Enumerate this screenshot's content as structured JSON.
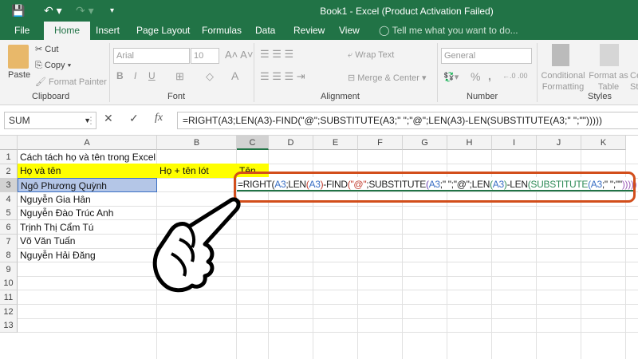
{
  "window": {
    "title": "Book1 - Excel (Product Activation Failed)"
  },
  "quick_access": {
    "save_icon": "save-icon",
    "undo_icon": "undo-icon",
    "redo_icon": "redo-icon",
    "customize_icon": "customize-icon"
  },
  "tabs": [
    {
      "label": "File"
    },
    {
      "label": "Home",
      "active": true
    },
    {
      "label": "Insert"
    },
    {
      "label": "Page Layout"
    },
    {
      "label": "Formulas"
    },
    {
      "label": "Data"
    },
    {
      "label": "Review"
    },
    {
      "label": "View"
    }
  ],
  "tell_me": "Tell me what you want to do...",
  "ribbon": {
    "clipboard": {
      "paste": "Paste",
      "cut": "Cut",
      "copy": "Copy",
      "format_painter": "Format Painter",
      "label": "Clipboard"
    },
    "font": {
      "font_name": "Arial",
      "font_size": "10",
      "label": "Font",
      "bold": "B",
      "italic": "I",
      "underline": "U",
      "font_color": "A"
    },
    "alignment": {
      "wrap_text": "Wrap Text",
      "merge_center": "Merge & Center",
      "label": "Alignment"
    },
    "number": {
      "format": "General",
      "percent": "%",
      "comma": ",",
      "label": "Number"
    },
    "styles": {
      "conditional_formatting": "Conditional Formatting",
      "format_as_table": "Format as Table",
      "cell_styles": "Cell Styles",
      "label": "Styles"
    }
  },
  "formula_bar": {
    "name_box": "SUM",
    "formula": "=RIGHT(A3;LEN(A3)-FIND(\"@\";SUBSTITUTE(A3;\" \";\"@\";LEN(A3)-LEN(SUBSTITUTE(A3;\" \";\"\")))))"
  },
  "columns": [
    "A",
    "B",
    "C",
    "D",
    "E",
    "F",
    "G",
    "H",
    "I",
    "J",
    "K"
  ],
  "rows": [
    "1",
    "2",
    "3",
    "4",
    "5",
    "6",
    "7",
    "8",
    "9",
    "10",
    "11",
    "12",
    "13"
  ],
  "cells": {
    "A1": "Cách tách họ và tên trong Excel",
    "A2": "Họ và tên",
    "B2": "Họ + tên lót",
    "C2": "Tên",
    "A3": "Ngô Phương Quỳnh",
    "A4": "Nguyễn Gia Hân",
    "A5": "Nguyễn Đào Trúc Anh",
    "A6": "Trịnh Thị Cẩm Tú",
    "A7": "Võ Văn Tuấn",
    "A8": "Nguyễn Hải Đăng"
  },
  "in_cell_formula": [
    {
      "t": "=RIGHT(",
      "c": "#222"
    },
    {
      "t": "A3",
      "c": "#3a6fc4"
    },
    {
      "t": ";LEN",
      "c": "#222"
    },
    {
      "t": "(",
      "c": "#c0392b"
    },
    {
      "t": "A3",
      "c": "#3a6fc4"
    },
    {
      "t": ")",
      "c": "#c0392b"
    },
    {
      "t": "-FIND",
      "c": "#222"
    },
    {
      "t": "(\"@\"",
      "c": "#c0392b"
    },
    {
      "t": ";SUBSTITUTE",
      "c": "#222"
    },
    {
      "t": "(",
      "c": "#6a3fb0"
    },
    {
      "t": "A3",
      "c": "#3a6fc4"
    },
    {
      "t": ";\" \";\"@\";LEN",
      "c": "#222"
    },
    {
      "t": "(",
      "c": "#2e8b57"
    },
    {
      "t": "A3",
      "c": "#3a6fc4"
    },
    {
      "t": ")",
      "c": "#2e8b57"
    },
    {
      "t": "-LEN",
      "c": "#222"
    },
    {
      "t": "(SUBSTITUTE",
      "c": "#2e8b57"
    },
    {
      "t": "(",
      "c": "#3a6fc4"
    },
    {
      "t": "A3",
      "c": "#3a6fc4"
    },
    {
      "t": ";\" \";\"\"",
      "c": "#222"
    },
    {
      "t": ")))))",
      "c": "#9b59b6"
    }
  ],
  "colors": {
    "brand": "#217346",
    "highlight": "#ffff00",
    "selection": "#b4c6e7",
    "callout": "#d24e1b"
  },
  "overlay": {
    "icon": "hand-pointer-icon"
  }
}
